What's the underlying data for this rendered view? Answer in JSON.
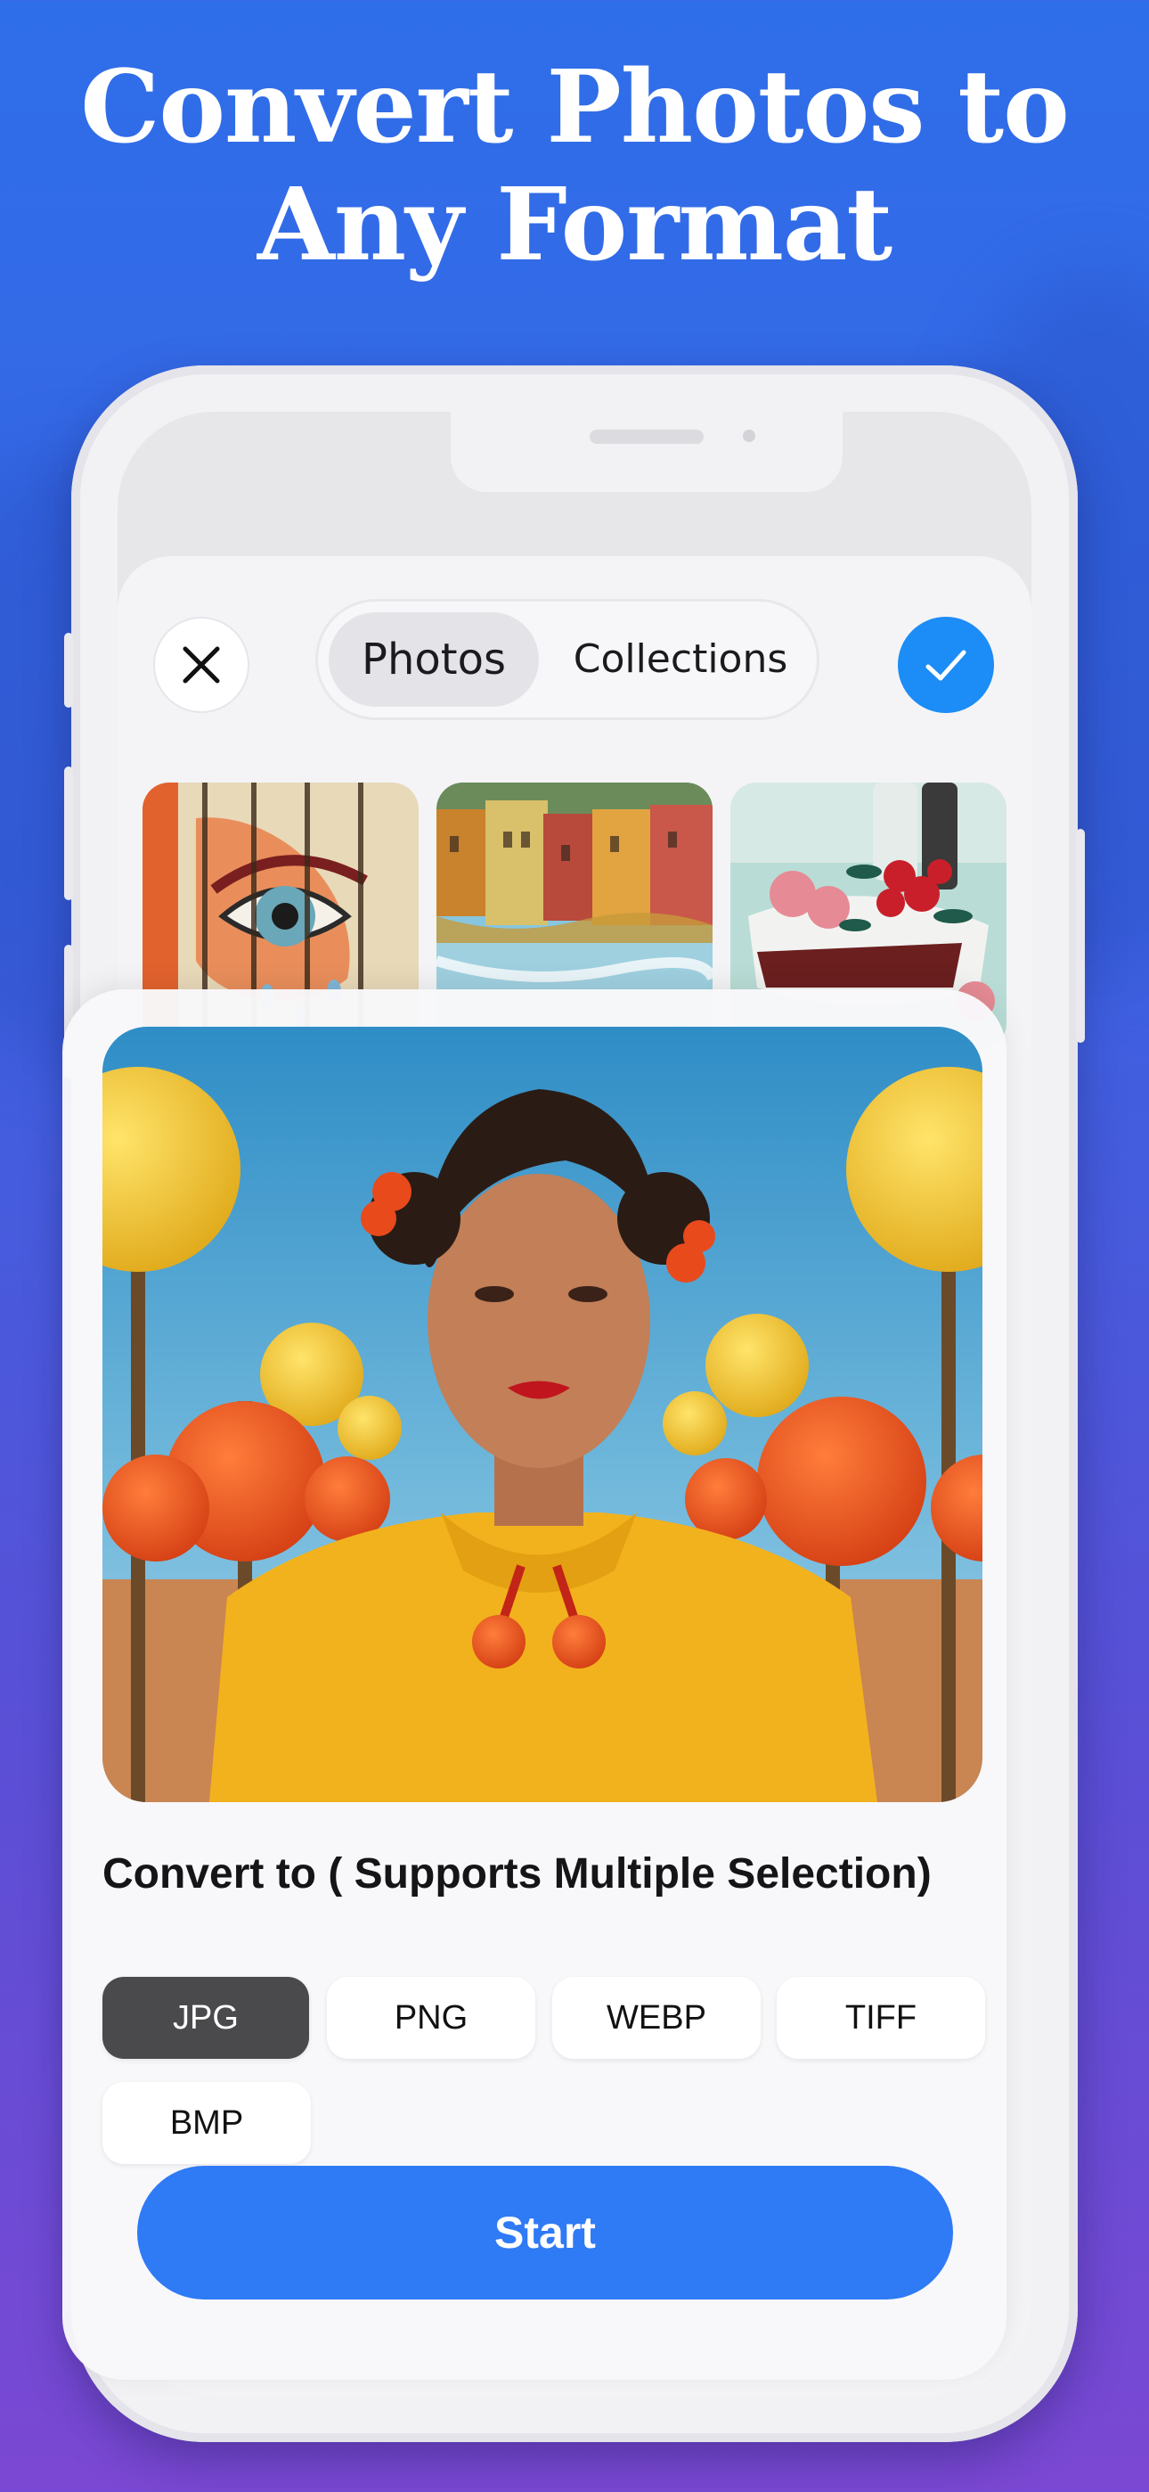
{
  "headline": {
    "line1": "Convert Photos to",
    "line2": "Any Format"
  },
  "toolbar": {
    "close_icon": "close-icon",
    "tabs": [
      {
        "label": "Photos",
        "selected": true
      },
      {
        "label": "Collections",
        "selected": false
      }
    ],
    "confirm_icon": "checkmark-icon"
  },
  "gallery": {
    "thumbnails": [
      "graffiti-eye-art",
      "colorful-buildings-reflection",
      "still-life-painting"
    ]
  },
  "preview": {
    "image": "woman-in-yellow-with-balloons"
  },
  "convert": {
    "label": "Convert to ( Supports Multiple Selection)",
    "formats": [
      {
        "label": "JPG",
        "selected": true
      },
      {
        "label": "PNG",
        "selected": false
      },
      {
        "label": "WEBP",
        "selected": false
      },
      {
        "label": "TIFF",
        "selected": false
      },
      {
        "label": "BMP",
        "selected": false
      }
    ]
  },
  "start_button": {
    "label": "Start"
  },
  "colors": {
    "accent": "#2f7af5",
    "confirm": "#1c8cf6",
    "selected_chip": "#4a4a4c"
  }
}
